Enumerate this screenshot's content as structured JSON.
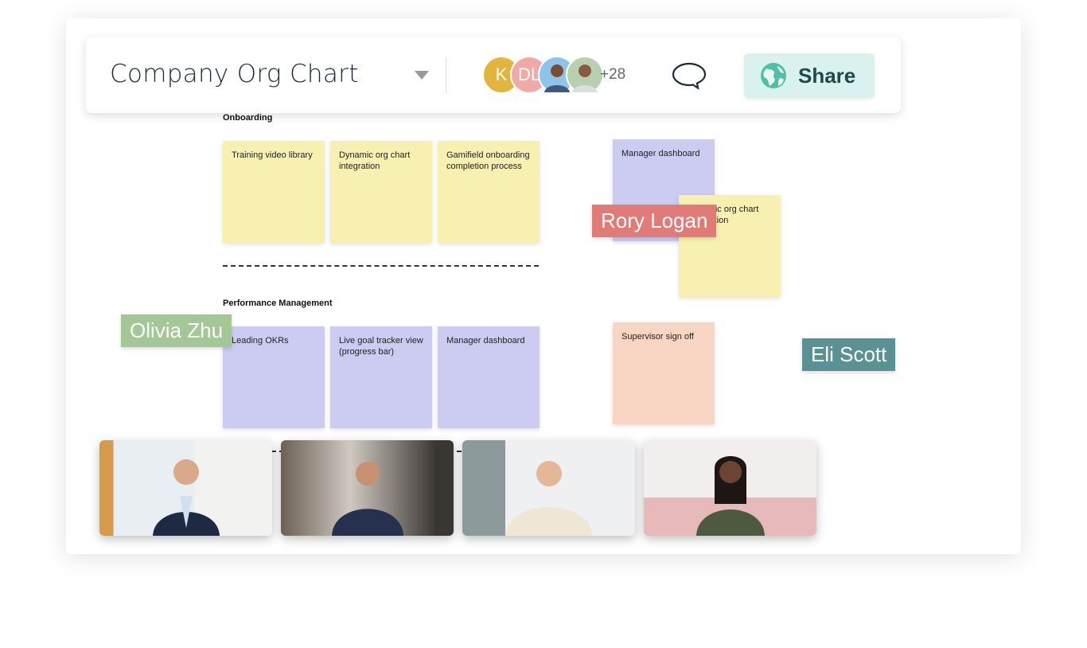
{
  "header": {
    "title": "Company Org Chart",
    "avatars": [
      {
        "initial": "K",
        "color": "#e3b53c"
      },
      {
        "initial": "DL",
        "color": "#f0a9a6"
      },
      {
        "initial": "",
        "color": "#8fc3e8"
      },
      {
        "initial": "",
        "color": "#b7d1b0"
      }
    ],
    "more_count": "+28",
    "share_label": "Share"
  },
  "sections": [
    {
      "title": "Onboarding",
      "stickies": [
        {
          "text": "Training video library",
          "color": "#f8f0b1"
        },
        {
          "text": "Dynamic org chart integration",
          "color": "#f8f0b1"
        },
        {
          "text": "Gamifield onboarding completion process",
          "color": "#f8f0b1"
        }
      ]
    },
    {
      "title": "Performance Management",
      "stickies": [
        {
          "text": "Leading OKRs",
          "color": "#cccbf2"
        },
        {
          "text": "Live goal tracker view (progress bar)",
          "color": "#cccbf2"
        },
        {
          "text": "Manager dashboard",
          "color": "#cccbf2"
        }
      ]
    }
  ],
  "loose_stickies": [
    {
      "text": "Manager dashboard",
      "color": "#cccbf2"
    },
    {
      "text": "Dynamic org chart integration",
      "color": "#f8f0b1"
    },
    {
      "text": "Supervisor sign off",
      "color": "#f9d5c3"
    }
  ],
  "cursors": [
    {
      "name": "Rory Logan",
      "color": "#e07b78"
    },
    {
      "name": "Olivia Zhu",
      "color": "#a3c796"
    },
    {
      "name": "Eli Scott",
      "color": "#5a9195"
    }
  ],
  "video_participants": 4
}
